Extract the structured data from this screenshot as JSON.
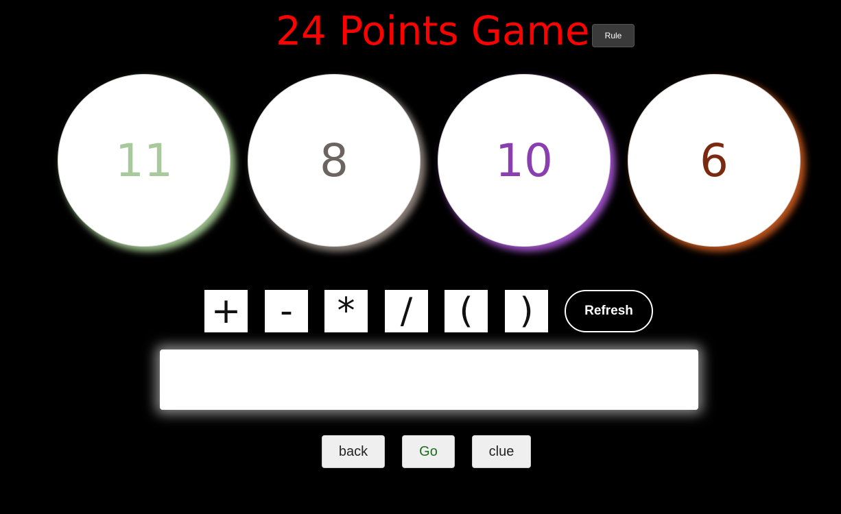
{
  "header": {
    "title": "24 Points Game",
    "rule_label": "Rule"
  },
  "cards": [
    {
      "value": "11",
      "color": "#a8c99c",
      "glow": "#9bbf8a"
    },
    {
      "value": "8",
      "color": "#6b6460",
      "glow": "#8a7f78"
    },
    {
      "value": "10",
      "color": "#8a3fb0",
      "glow": "#9b4fc4"
    },
    {
      "value": "6",
      "color": "#7a2a10",
      "glow": "#b9521c"
    }
  ],
  "operators": [
    "+",
    "-",
    "*",
    "/",
    "(",
    ")"
  ],
  "refresh_label": "Refresh",
  "expression": {
    "value": "",
    "placeholder": ""
  },
  "actions": {
    "back_label": "back",
    "go_label": "Go",
    "go_color": "#1e6b1e",
    "clue_label": "clue"
  }
}
